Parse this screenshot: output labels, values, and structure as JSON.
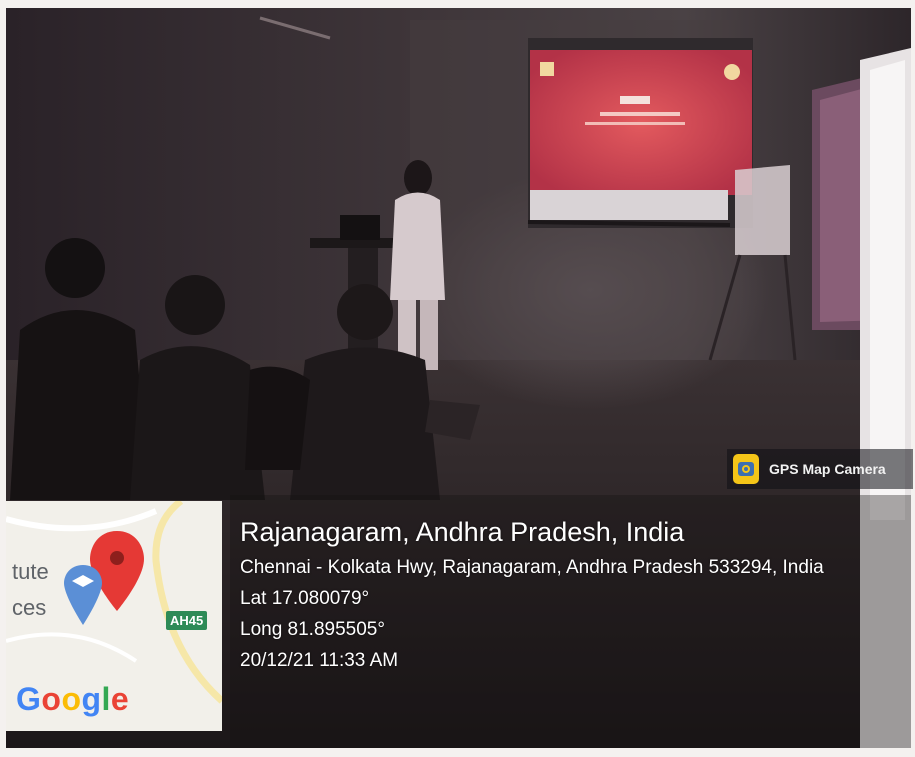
{
  "map": {
    "partial_labels": [
      "tute",
      "ces"
    ],
    "route_badge": "AH45",
    "google_letters": [
      {
        "char": "G",
        "color": "#4285F4"
      },
      {
        "char": "o",
        "color": "#EA4335"
      },
      {
        "char": "o",
        "color": "#FBBC05"
      },
      {
        "char": "g",
        "color": "#4285F4"
      },
      {
        "char": "l",
        "color": "#34A853"
      },
      {
        "char": "e",
        "color": "#EA4335"
      }
    ],
    "pin_color": "#E53935",
    "education_marker_color": "#5b8fd6",
    "icons": [
      "location-pin-icon",
      "education-marker-icon"
    ]
  },
  "badge": {
    "label": "GPS Map Camera",
    "icon": "gps-map-camera-icon"
  },
  "location": {
    "title": "Rajanagaram, Andhra Pradesh, India",
    "address": "Chennai - Kolkata Hwy, Rajanagaram, Andhra Pradesh 533294, India",
    "lat": "Lat 17.080079°",
    "long": "Long 81.895505°",
    "datetime": "20/12/21 11:33 AM"
  }
}
